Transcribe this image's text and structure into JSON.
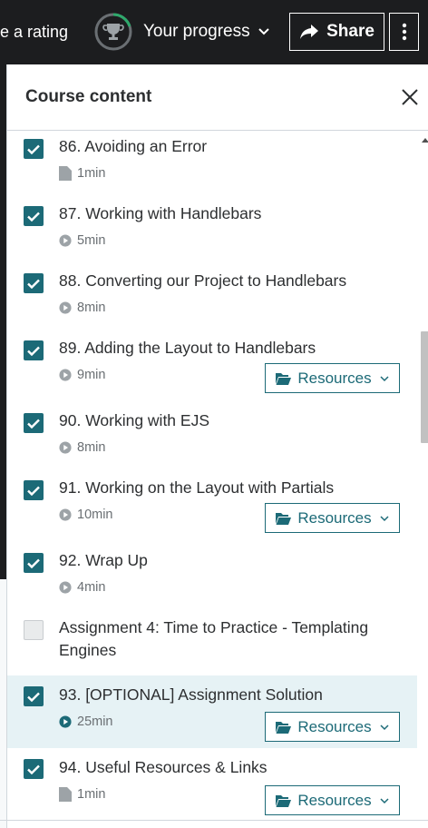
{
  "topbar": {
    "rating_text": "e a rating",
    "progress_label": "Your progress",
    "share_label": "Share"
  },
  "panel": {
    "title": "Course content"
  },
  "colors": {
    "topbar_bg": "#1c1d1f",
    "accent": "#1c6a77",
    "progress_ring": "#2ea86b",
    "active_row": "#e6f2f5"
  },
  "items": [
    {
      "title": "86. Avoiding an Error",
      "duration": "1min",
      "icon": "article-icon",
      "checked": true
    },
    {
      "title": "87. Working with Handlebars",
      "duration": "5min",
      "icon": "play-icon",
      "checked": true
    },
    {
      "title": "88. Converting our Project to Handlebars",
      "duration": "8min",
      "icon": "play-icon",
      "checked": true
    },
    {
      "title": "89. Adding the Layout to Handlebars",
      "duration": "9min",
      "icon": "play-icon",
      "checked": true,
      "resources": "Resources"
    },
    {
      "title": "90. Working with EJS",
      "duration": "8min",
      "icon": "play-icon",
      "checked": true
    },
    {
      "title": "91. Working on the Layout with Partials",
      "duration": "10min",
      "icon": "play-icon",
      "checked": true,
      "resources": "Resources"
    },
    {
      "title": "92. Wrap Up",
      "duration": "4min",
      "icon": "play-icon",
      "checked": true
    },
    {
      "title": "Assignment 4: Time to Practice - Templating Engines",
      "checked": false
    },
    {
      "title": "93. [OPTIONAL] Assignment Solution",
      "duration": "25min",
      "icon": "play-icon",
      "checked": true,
      "resources": "Resources",
      "active": true
    },
    {
      "title": "94. Useful Resources & Links",
      "duration": "1min",
      "icon": "article-icon",
      "checked": true,
      "resources": "Resources"
    }
  ]
}
